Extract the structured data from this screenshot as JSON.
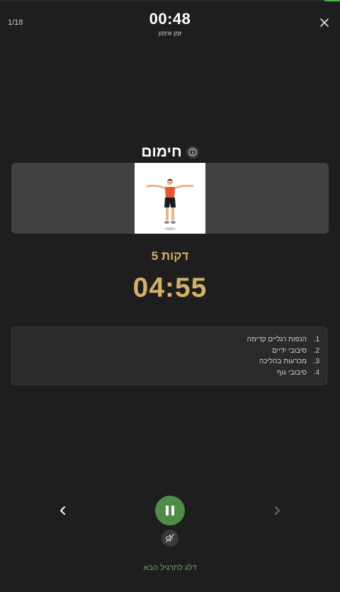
{
  "header": {
    "counter": "1/18",
    "timer": "00:48",
    "timer_label": "זמן אימון",
    "close_icon": "close-icon"
  },
  "exercise": {
    "title": "חימום",
    "info_icon": "info-icon",
    "duration": "5 דקות",
    "countdown": "04:55",
    "steps": [
      {
        "num": "1.",
        "text": "הנפות רגליים קדימה"
      },
      {
        "num": "2.",
        "text": "סיבובי ידיים"
      },
      {
        "num": "3.",
        "text": "מכרעות בהליכה"
      },
      {
        "num": "4.",
        "text": "סיבובי גוף"
      }
    ]
  },
  "controls": {
    "prev_icon": "chevron-left-icon",
    "next_icon": "chevron-right-icon",
    "pause_icon": "pause-icon",
    "mute_icon": "mute-icon",
    "skip_label": "דלג לתרגיל הבא"
  },
  "colors": {
    "accent_gold": "#d4b06a",
    "accent_green": "#4e8c47",
    "background": "#1e1e1e"
  }
}
